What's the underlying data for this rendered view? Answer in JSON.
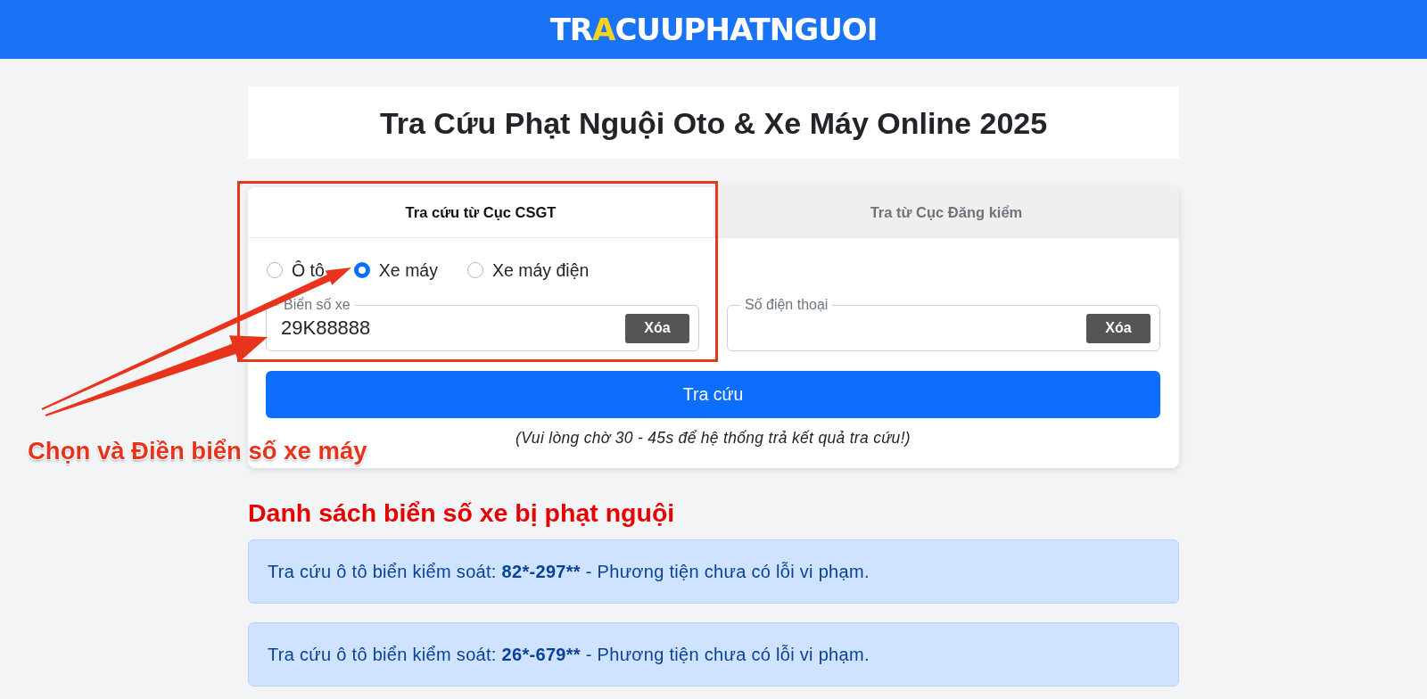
{
  "header": {
    "logo": [
      {
        "text": "TR",
        "highlighted": false
      },
      {
        "text": "A",
        "highlighted": true
      },
      {
        "text": "CUUPHATNGUOI",
        "highlighted": false
      }
    ]
  },
  "title": "Tra Cứu Phạt Nguội Oto & Xe Máy Online 2025",
  "lookup_form": {
    "tabs": [
      {
        "label": "Tra cứu từ Cục CSGT",
        "selected": true
      },
      {
        "label": "Tra từ Cục Đăng kiểm",
        "selected": false
      }
    ],
    "vehicle_types": [
      {
        "label": "Ô tô",
        "selected": false
      },
      {
        "label": "Xe máy",
        "selected": true
      },
      {
        "label": "Xe máy điện",
        "selected": false
      }
    ],
    "fields": [
      {
        "label": "Biển số xe",
        "value": "29K88888",
        "clear_button": "Xóa"
      },
      {
        "label": "Số điện thoại",
        "clear_button": "Xóa"
      }
    ],
    "submit_button": "Tra cứu",
    "note": "(Vui lòng chờ 30 - 45s để hệ thống trả kết quả tra cứu!)"
  },
  "violations_list": {
    "heading": "Danh sách biển số xe bị phạt nguội",
    "items": [
      {
        "prefix": "Tra cứu ô tô biển kiểm soát:",
        "plate": "82*-297**",
        "suffix": "- Phương tiện chưa có lỗi vi phạm."
      },
      {
        "prefix": "Tra cứu ô tô biển kiểm soát:",
        "plate": "26*-679**",
        "suffix": "- Phương tiện chưa có lỗi vi phạm."
      }
    ]
  },
  "annotation": {
    "text": "Chọn và Điền biển số xe máy"
  }
}
